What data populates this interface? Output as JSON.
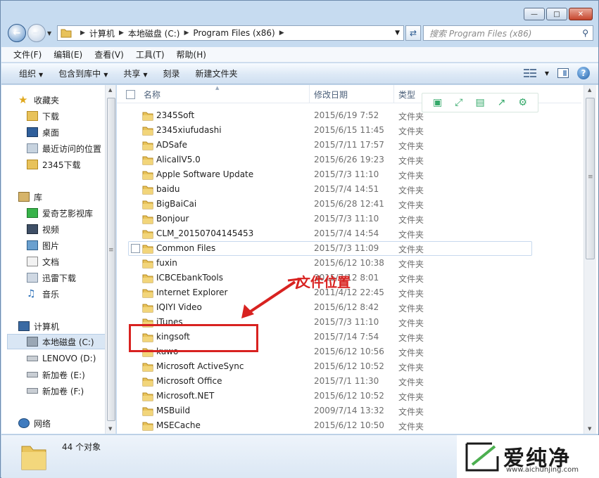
{
  "window": {
    "caption_buttons": [
      "minimize",
      "maximize",
      "close"
    ]
  },
  "address": {
    "crumbs": [
      "计算机",
      "本地磁盘 (C:)",
      "Program Files (x86)"
    ],
    "search_placeholder": "搜索 Program Files (x86)"
  },
  "menu": [
    "文件(F)",
    "编辑(E)",
    "查看(V)",
    "工具(T)",
    "帮助(H)"
  ],
  "toolbar": {
    "organize": "组织",
    "include_library": "包含到库中",
    "share": "共享",
    "burn": "刻录",
    "new_folder": "新建文件夹"
  },
  "nav": {
    "favorites": {
      "title": "收藏夹",
      "items": [
        "下载",
        "桌面",
        "最近访问的位置",
        "2345下载"
      ]
    },
    "libraries": {
      "title": "库",
      "items": [
        "爱奇艺影视库",
        "视频",
        "图片",
        "文档",
        "迅雷下载",
        "音乐"
      ]
    },
    "computer": {
      "title": "计算机",
      "items": [
        "本地磁盘 (C:)",
        "LENOVO (D:)",
        "新加卷 (E:)",
        "新加卷 (F:)"
      ],
      "selected": "本地磁盘 (C:)"
    },
    "network": {
      "title": "网络"
    }
  },
  "columns": {
    "name": "名称",
    "date": "修改日期",
    "type": "类型"
  },
  "files": [
    {
      "name": "2345Soft",
      "date": "2015/6/19 7:52",
      "type": "文件夹"
    },
    {
      "name": "2345xiufudashi",
      "date": "2015/6/15 11:45",
      "type": "文件夹"
    },
    {
      "name": "ADSafe",
      "date": "2015/7/11 17:57",
      "type": "文件夹"
    },
    {
      "name": "AlicallV5.0",
      "date": "2015/6/26 19:23",
      "type": "文件夹"
    },
    {
      "name": "Apple Software Update",
      "date": "2015/7/3 11:10",
      "type": "文件夹"
    },
    {
      "name": "baidu",
      "date": "2015/7/4 14:51",
      "type": "文件夹"
    },
    {
      "name": "BigBaiCai",
      "date": "2015/6/28 12:41",
      "type": "文件夹"
    },
    {
      "name": "Bonjour",
      "date": "2015/7/3 11:10",
      "type": "文件夹"
    },
    {
      "name": "CLM_20150704145453",
      "date": "2015/7/4 14:54",
      "type": "文件夹"
    },
    {
      "name": "Common Files",
      "date": "2015/7/3 11:09",
      "type": "文件夹"
    },
    {
      "name": "fuxin",
      "date": "2015/6/12 10:38",
      "type": "文件夹"
    },
    {
      "name": "ICBCEbankTools",
      "date": "2015/7/12 8:01",
      "type": "文件夹"
    },
    {
      "name": "Internet Explorer",
      "date": "2011/4/12 22:45",
      "type": "文件夹"
    },
    {
      "name": "IQIYI Video",
      "date": "2015/6/12 8:42",
      "type": "文件夹"
    },
    {
      "name": "iTunes",
      "date": "2015/7/3 11:10",
      "type": "文件夹"
    },
    {
      "name": "kingsoft",
      "date": "2015/7/14 7:54",
      "type": "文件夹"
    },
    {
      "name": "kuwo",
      "date": "2015/6/12 10:56",
      "type": "文件夹"
    },
    {
      "name": "Microsoft ActiveSync",
      "date": "2015/6/12 10:52",
      "type": "文件夹"
    },
    {
      "name": "Microsoft Office",
      "date": "2015/7/1 11:30",
      "type": "文件夹"
    },
    {
      "name": "Microsoft.NET",
      "date": "2015/6/12 10:52",
      "type": "文件夹"
    },
    {
      "name": "MSBuild",
      "date": "2009/7/14 13:32",
      "type": "文件夹"
    },
    {
      "name": "MSECache",
      "date": "2015/6/12 10:50",
      "type": "文件夹"
    }
  ],
  "hover_row": "Common Files",
  "annotation": {
    "label": "文件位置",
    "target": "kingsoft",
    "color": "#d82220"
  },
  "float_tools": [
    "window-icon",
    "expand-icon",
    "save-icon",
    "share-icon",
    "settings-icon"
  ],
  "status": {
    "count": "44 个对象"
  },
  "watermark": {
    "brand": "爱纯净",
    "url": "www.aichunjing.com"
  }
}
